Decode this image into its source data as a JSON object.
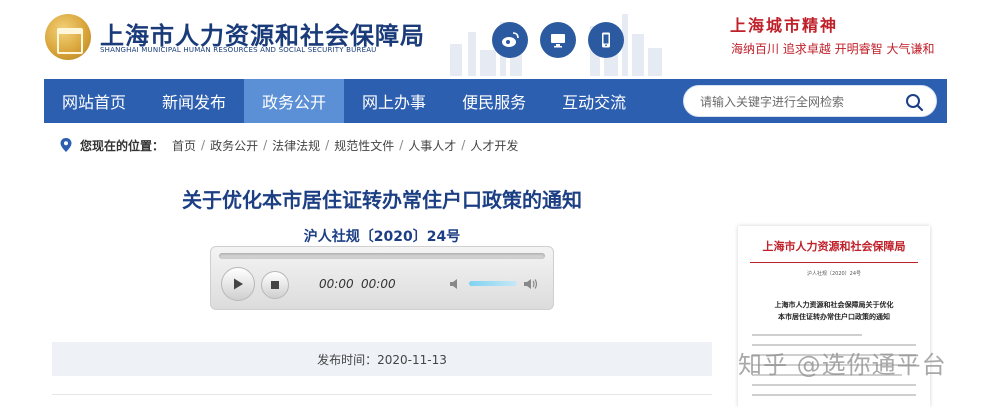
{
  "header": {
    "logo_cn": "上海市人力资源和社会保障局",
    "logo_en": "SHANGHAI MUNICIPAL HUMAN RESOURCES AND SOCIAL SECURITY BUREAU",
    "logo_icon": "bureau-emblem",
    "social": [
      {
        "name": "weibo",
        "icon": "weibo-icon"
      },
      {
        "name": "pc",
        "icon": "desktop-icon"
      },
      {
        "name": "mobile",
        "icon": "mobile-icon"
      }
    ],
    "city_title": "上海城市精神",
    "city_slogan": "海纳百川  追求卓越  开明睿智  大气谦和"
  },
  "nav": {
    "items": [
      {
        "label": "网站首页",
        "active": false
      },
      {
        "label": "新闻发布",
        "active": false
      },
      {
        "label": "政务公开",
        "active": true
      },
      {
        "label": "网上办事",
        "active": false
      },
      {
        "label": "便民服务",
        "active": false
      },
      {
        "label": "互动交流",
        "active": false
      }
    ],
    "search_placeholder": "请输入关键字进行全网检索"
  },
  "breadcrumb": {
    "label": "您现在的位置：",
    "items": [
      "首页",
      "政务公开",
      "法律法规",
      "规范性文件",
      "人事人才",
      "人才开发"
    ]
  },
  "article": {
    "title": "关于优化本市居住证转办常住户口政策的通知",
    "doc_no": "沪人社规〔2020〕24号",
    "publish": "发布时间：2020-11-13"
  },
  "player": {
    "current_time": "00:00",
    "duration": "00:00",
    "progress": 0,
    "volume": 0.8
  },
  "thumbnail": {
    "header": "上海市人力资源和社会保障局",
    "doc_no": "沪人社规〔2020〕24号",
    "title_line1": "上海市人力资源和社会保障局关于优化",
    "title_line2": "本市居住证转办常住户口政策的通知"
  },
  "watermark": "知乎 @选你通平台",
  "colors": {
    "nav_bg": "#2d5fb0",
    "nav_active": "#5b8fd6",
    "title": "#1c3f84",
    "brand_red": "#c0202a",
    "pub_bar": "#eef1f6"
  }
}
